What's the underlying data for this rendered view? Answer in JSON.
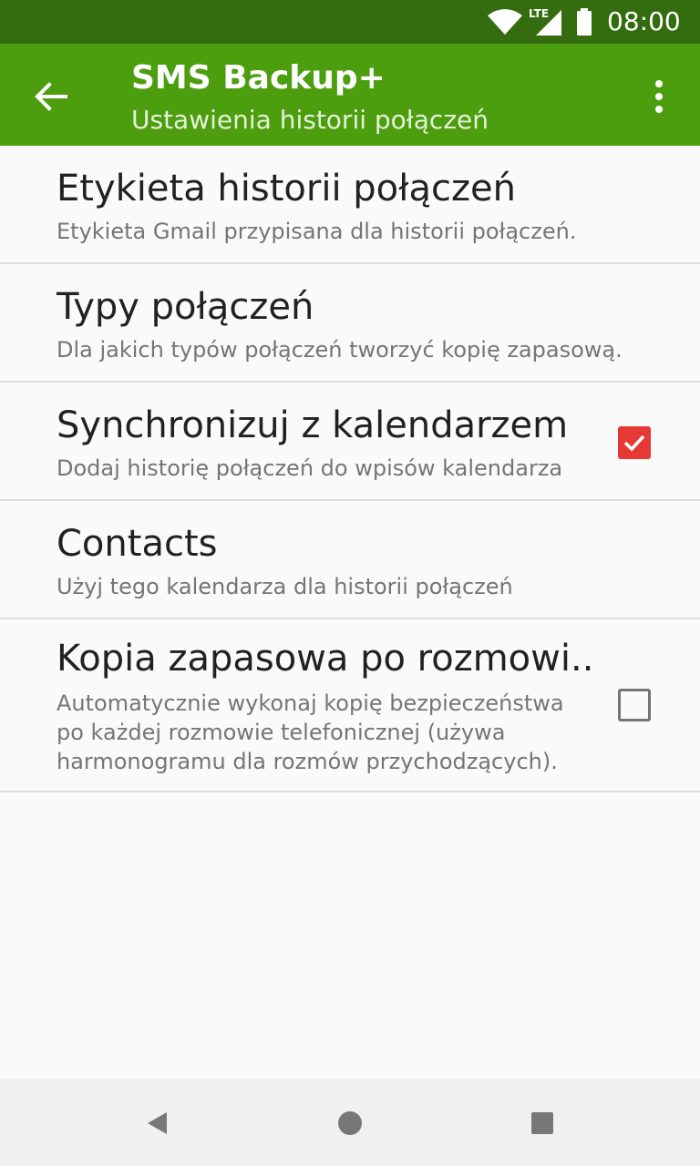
{
  "status_bar": {
    "network": "LTE",
    "time": "08:00",
    "icons": [
      "wifi-icon",
      "signal-icon",
      "battery-icon"
    ]
  },
  "app_bar": {
    "title": "SMS Backup+",
    "subtitle": "Ustawienia historii połączeń",
    "icons": [
      "back-arrow-icon",
      "more-vert-icon"
    ]
  },
  "settings": [
    {
      "title": "Etykieta historii połączeń",
      "summary": "Etykieta Gmail przypisana dla historii połączeń."
    },
    {
      "title": "Typy połączeń",
      "summary": "Dla jakich typów połączeń tworzyć kopię zapasową."
    },
    {
      "title": "Synchronizuj z kalendarzem",
      "summary": "Dodaj historię połączeń do wpisów kalendarza",
      "checked": true
    },
    {
      "title": "Contacts",
      "summary": "Użyj tego kalendarza dla historii połączeń"
    },
    {
      "title": "Kopia zapasowa po rozmowi..",
      "summary_lines": [
        "Automatycznie wykonaj kopię bezpieczeństwa",
        "po każdej rozmowie telefonicznej (używa",
        "harmonogramu dla rozmów przychodzących)."
      ],
      "checked": false
    }
  ],
  "nav_bar": {
    "icons": [
      "back-triangle-icon",
      "home-circle-icon",
      "recents-square-icon"
    ]
  },
  "colors": {
    "status_bar": "#336d0f",
    "app_bar": "#4d9e0f",
    "checkbox_checked": "#e53935",
    "background": "#fafafa"
  }
}
